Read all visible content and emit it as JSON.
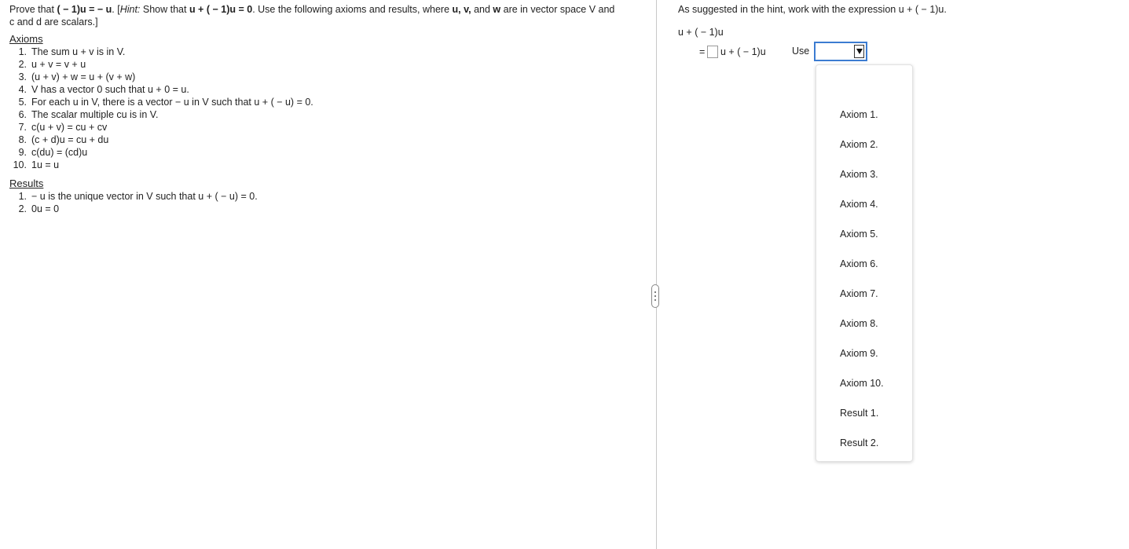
{
  "problem": {
    "prove_lead": "Prove that ",
    "prove_expr": "( − 1)u = − u",
    "prove_after": ". ",
    "hint_label": "Hint:",
    "hint_text_1": " Show that ",
    "hint_expr": "u + ( − 1)u = 0",
    "hint_text_2": ". Use the following axioms and results, where ",
    "vars": "u, v,",
    "and_word": " and ",
    "w": "w",
    "hint_text_3": " are in vector space V and",
    "line2": "c and d are scalars.]"
  },
  "axioms_heading": "Axioms",
  "axioms": [
    {
      "num": "1.",
      "text": "The sum u + v is in V."
    },
    {
      "num": "2.",
      "text": "u + v = v + u"
    },
    {
      "num": "3.",
      "text": "(u + v) + w = u + (v + w)"
    },
    {
      "num": "4.",
      "text": "V has a vector 0 such that u + 0 = u."
    },
    {
      "num": "5.",
      "text": "For each u in V, there is a vector  − u in V such that u + ( − u) = 0."
    },
    {
      "num": "6.",
      "text": "The scalar multiple cu is in V."
    },
    {
      "num": "7.",
      "text": "c(u + v) = cu + cv"
    },
    {
      "num": "8.",
      "text": "(c + d)u = cu + du"
    },
    {
      "num": "9.",
      "text": "c(du) = (cd)u"
    },
    {
      "num": "10.",
      "text": "1u = u"
    }
  ],
  "results_heading": "Results",
  "results": [
    {
      "num": "1.",
      "text": " − u is the unique vector in V such that u + ( − u) = 0."
    },
    {
      "num": "2.",
      "text": "0u = 0"
    }
  ],
  "work": {
    "intro": "As suggested in the hint, work with the expression u + ( − 1)u.",
    "start_expr": "u + ( − 1)u",
    "step_eq": "=",
    "step_expr": "u + ( − 1)u",
    "use_label": "Use"
  },
  "dropdown": {
    "selected": "",
    "options": [
      "Axiom 1.",
      "Axiom 2.",
      "Axiom 3.",
      "Axiom 4.",
      "Axiom 5.",
      "Axiom 6.",
      "Axiom 7.",
      "Axiom 8.",
      "Axiom 9.",
      "Axiom 10.",
      "Result 1.",
      "Result 2."
    ]
  },
  "colors": {
    "focus_border": "#3c7cd1",
    "divider": "#c8c8c8"
  }
}
